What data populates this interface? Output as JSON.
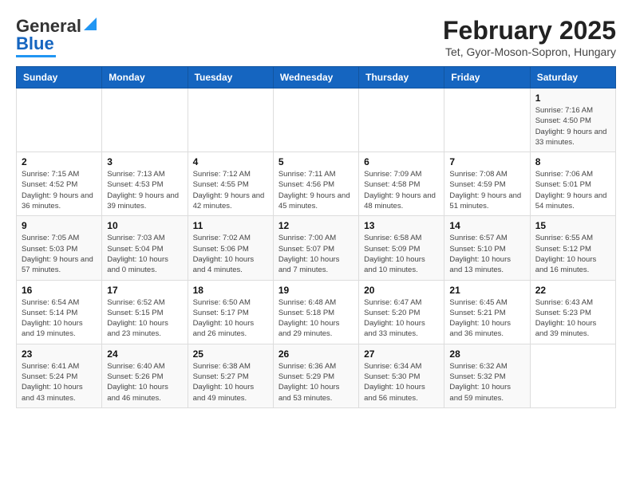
{
  "logo": {
    "general": "General",
    "blue": "Blue"
  },
  "title": "February 2025",
  "subtitle": "Tet, Gyor-Moson-Sopron, Hungary",
  "headers": [
    "Sunday",
    "Monday",
    "Tuesday",
    "Wednesday",
    "Thursday",
    "Friday",
    "Saturday"
  ],
  "weeks": [
    [
      {
        "day": "",
        "info": ""
      },
      {
        "day": "",
        "info": ""
      },
      {
        "day": "",
        "info": ""
      },
      {
        "day": "",
        "info": ""
      },
      {
        "day": "",
        "info": ""
      },
      {
        "day": "",
        "info": ""
      },
      {
        "day": "1",
        "info": "Sunrise: 7:16 AM\nSunset: 4:50 PM\nDaylight: 9 hours and 33 minutes."
      }
    ],
    [
      {
        "day": "2",
        "info": "Sunrise: 7:15 AM\nSunset: 4:52 PM\nDaylight: 9 hours and 36 minutes."
      },
      {
        "day": "3",
        "info": "Sunrise: 7:13 AM\nSunset: 4:53 PM\nDaylight: 9 hours and 39 minutes."
      },
      {
        "day": "4",
        "info": "Sunrise: 7:12 AM\nSunset: 4:55 PM\nDaylight: 9 hours and 42 minutes."
      },
      {
        "day": "5",
        "info": "Sunrise: 7:11 AM\nSunset: 4:56 PM\nDaylight: 9 hours and 45 minutes."
      },
      {
        "day": "6",
        "info": "Sunrise: 7:09 AM\nSunset: 4:58 PM\nDaylight: 9 hours and 48 minutes."
      },
      {
        "day": "7",
        "info": "Sunrise: 7:08 AM\nSunset: 4:59 PM\nDaylight: 9 hours and 51 minutes."
      },
      {
        "day": "8",
        "info": "Sunrise: 7:06 AM\nSunset: 5:01 PM\nDaylight: 9 hours and 54 minutes."
      }
    ],
    [
      {
        "day": "9",
        "info": "Sunrise: 7:05 AM\nSunset: 5:03 PM\nDaylight: 9 hours and 57 minutes."
      },
      {
        "day": "10",
        "info": "Sunrise: 7:03 AM\nSunset: 5:04 PM\nDaylight: 10 hours and 0 minutes."
      },
      {
        "day": "11",
        "info": "Sunrise: 7:02 AM\nSunset: 5:06 PM\nDaylight: 10 hours and 4 minutes."
      },
      {
        "day": "12",
        "info": "Sunrise: 7:00 AM\nSunset: 5:07 PM\nDaylight: 10 hours and 7 minutes."
      },
      {
        "day": "13",
        "info": "Sunrise: 6:58 AM\nSunset: 5:09 PM\nDaylight: 10 hours and 10 minutes."
      },
      {
        "day": "14",
        "info": "Sunrise: 6:57 AM\nSunset: 5:10 PM\nDaylight: 10 hours and 13 minutes."
      },
      {
        "day": "15",
        "info": "Sunrise: 6:55 AM\nSunset: 5:12 PM\nDaylight: 10 hours and 16 minutes."
      }
    ],
    [
      {
        "day": "16",
        "info": "Sunrise: 6:54 AM\nSunset: 5:14 PM\nDaylight: 10 hours and 19 minutes."
      },
      {
        "day": "17",
        "info": "Sunrise: 6:52 AM\nSunset: 5:15 PM\nDaylight: 10 hours and 23 minutes."
      },
      {
        "day": "18",
        "info": "Sunrise: 6:50 AM\nSunset: 5:17 PM\nDaylight: 10 hours and 26 minutes."
      },
      {
        "day": "19",
        "info": "Sunrise: 6:48 AM\nSunset: 5:18 PM\nDaylight: 10 hours and 29 minutes."
      },
      {
        "day": "20",
        "info": "Sunrise: 6:47 AM\nSunset: 5:20 PM\nDaylight: 10 hours and 33 minutes."
      },
      {
        "day": "21",
        "info": "Sunrise: 6:45 AM\nSunset: 5:21 PM\nDaylight: 10 hours and 36 minutes."
      },
      {
        "day": "22",
        "info": "Sunrise: 6:43 AM\nSunset: 5:23 PM\nDaylight: 10 hours and 39 minutes."
      }
    ],
    [
      {
        "day": "23",
        "info": "Sunrise: 6:41 AM\nSunset: 5:24 PM\nDaylight: 10 hours and 43 minutes."
      },
      {
        "day": "24",
        "info": "Sunrise: 6:40 AM\nSunset: 5:26 PM\nDaylight: 10 hours and 46 minutes."
      },
      {
        "day": "25",
        "info": "Sunrise: 6:38 AM\nSunset: 5:27 PM\nDaylight: 10 hours and 49 minutes."
      },
      {
        "day": "26",
        "info": "Sunrise: 6:36 AM\nSunset: 5:29 PM\nDaylight: 10 hours and 53 minutes."
      },
      {
        "day": "27",
        "info": "Sunrise: 6:34 AM\nSunset: 5:30 PM\nDaylight: 10 hours and 56 minutes."
      },
      {
        "day": "28",
        "info": "Sunrise: 6:32 AM\nSunset: 5:32 PM\nDaylight: 10 hours and 59 minutes."
      },
      {
        "day": "",
        "info": ""
      }
    ]
  ]
}
